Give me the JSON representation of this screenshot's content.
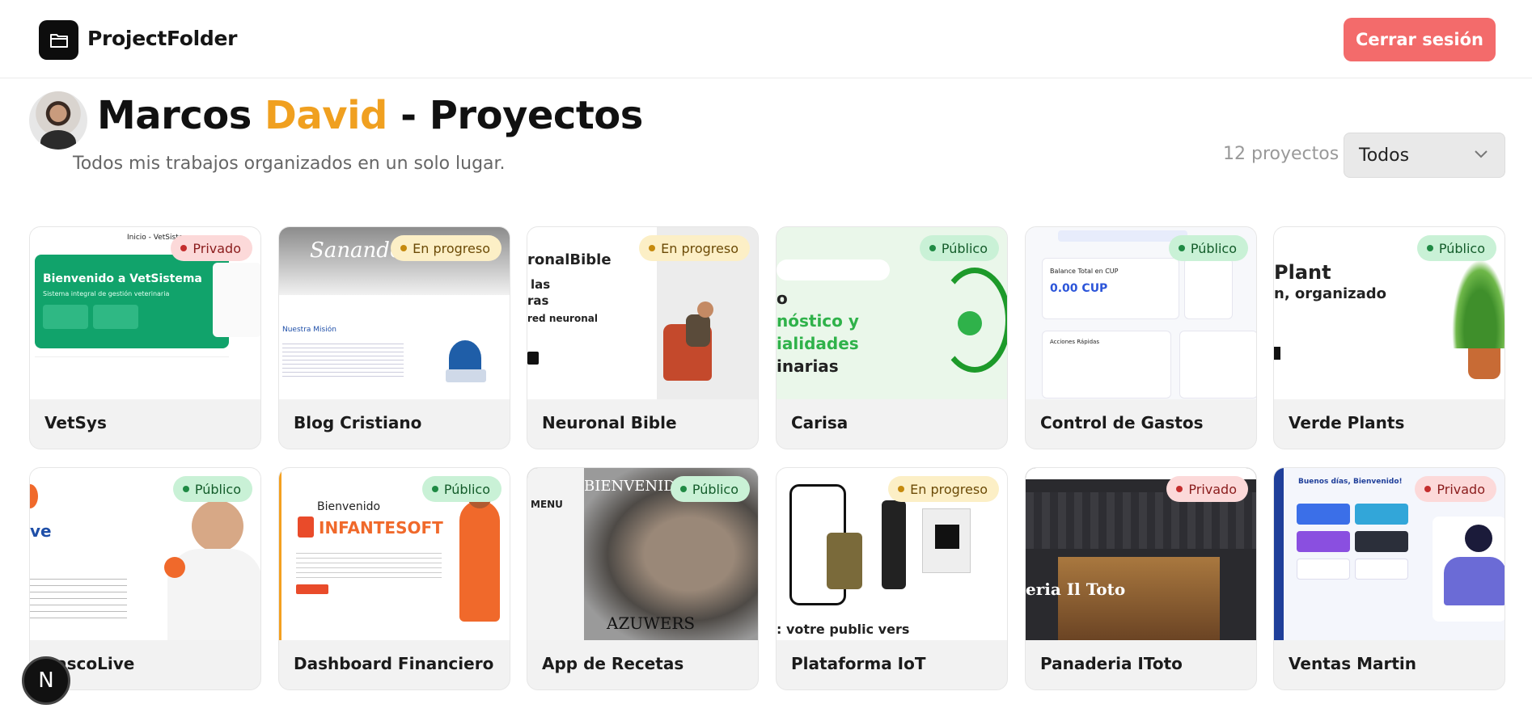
{
  "header": {
    "brand": "ProjectFolder",
    "logout_label": "Cerrar sesión"
  },
  "page": {
    "title_first": "Marcos ",
    "title_accent": "David",
    "title_rest": " - Proyectos",
    "subtitle": "Todos mis trabajos organizados en un solo lugar.",
    "count_label": "12 proyectos",
    "filter_value": "Todos"
  },
  "colors": {
    "accent": "#f0a020",
    "logout": "#f36b6b",
    "privado": "#fcd9d9",
    "progreso": "#fcefc6",
    "publico": "#c9f1d6"
  },
  "projects": [
    {
      "name": "VetSys",
      "status": "Privado"
    },
    {
      "name": "Blog Cristiano",
      "status": "En progreso"
    },
    {
      "name": "Neuronal Bible",
      "status": "En progreso"
    },
    {
      "name": "Carisa",
      "status": "Público"
    },
    {
      "name": "Control de Gastos",
      "status": "Público"
    },
    {
      "name": "Verde Plants",
      "status": "Público"
    },
    {
      "name": "PascoLive",
      "status": "Público"
    },
    {
      "name": "Dashboard Financiero",
      "status": "Público"
    },
    {
      "name": "App de Recetas",
      "status": "Público"
    },
    {
      "name": "Plataforma IoT",
      "status": "En progreso"
    },
    {
      "name": "Panaderia IToto",
      "status": "Privado"
    },
    {
      "name": "Ventas Martin",
      "status": "Privado"
    }
  ],
  "thumbs": {
    "vetsys_title": "Bienvenido a VetSistema",
    "vetsys_sub": "Sistema integral de gestión veterinaria",
    "vetsys_top": "Inicio - VetSistema",
    "blog_script": "Sanando el",
    "blog_mision": "Nuestra Misión",
    "neuronal_brand": "ronalBible",
    "neuronal_l1": "las",
    "neuronal_l2": "ras",
    "neuronal_l3": "red neuronal",
    "carisa_l1": "o",
    "carisa_l2": "nóstico y",
    "carisa_l3": "ialidades",
    "carisa_l4": "inarias",
    "gastos_label": "Balance Total en CUP",
    "gastos_value": "0.00 CUP",
    "gastos_actions": "Acciones Rápidas",
    "plants_l1": "Plant",
    "plants_l2": "n, organizado",
    "pasco_logo": "ve",
    "infante_hello": "Bienvenido",
    "infante_brand": "INFANTESOFT",
    "recetas_menu": "MENU",
    "recetas_welcome": "BIENVENIDO!",
    "recetas_brand": "AZUWERS",
    "iot_bottom": ": votre public vers",
    "panaderia_sign": "eria Il Toto",
    "ventas_greet": "Buenos días, Bienvenido!"
  },
  "fab_label": "N"
}
